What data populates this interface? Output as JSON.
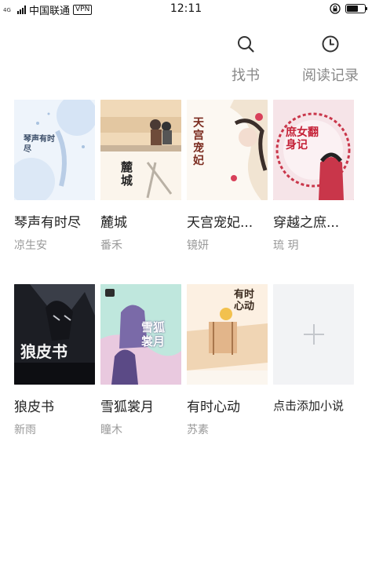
{
  "status_bar": {
    "network": "4G",
    "carrier": "中国联通",
    "vpn": "VPN",
    "time": "12:11",
    "battery_level": 0.65
  },
  "actions": {
    "find_book": "找书",
    "history": "阅读记录"
  },
  "books": [
    {
      "title": "琴声有时尽",
      "author": "凉生安",
      "cover_text": "琴声有时尽",
      "cover_colors": [
        "#eaf2fb",
        "#c7d9f0"
      ]
    },
    {
      "title": "麓城",
      "author": "番禾",
      "cover_text": "麓城",
      "cover_colors": [
        "#f6e7d4",
        "#d9c5a8"
      ]
    },
    {
      "title": "天宫宠妃...",
      "author": "镜妍",
      "cover_text": "天宫宠妃",
      "cover_colors": [
        "#fbf7f1",
        "#eadfcf"
      ]
    },
    {
      "title": "穿越之庶...",
      "author": "琉 玥",
      "cover_text": "庶女翻身记",
      "cover_colors": [
        "#f7e9ec",
        "#c9364a"
      ]
    },
    {
      "title": "狼皮书",
      "author": "新雨",
      "cover_text": "狼皮书",
      "cover_colors": [
        "#2d3038",
        "#0f1014"
      ]
    },
    {
      "title": "雪狐裳月",
      "author": "瞳木",
      "cover_text": "雪狐裳月",
      "cover_colors": [
        "#b9e6dc",
        "#e8c9de"
      ]
    },
    {
      "title": "有时心动",
      "author": "苏素",
      "cover_text": "有时心动",
      "cover_colors": [
        "#fbeede",
        "#e9c9a5"
      ]
    }
  ],
  "add_book": {
    "label": "点击添加小说"
  }
}
